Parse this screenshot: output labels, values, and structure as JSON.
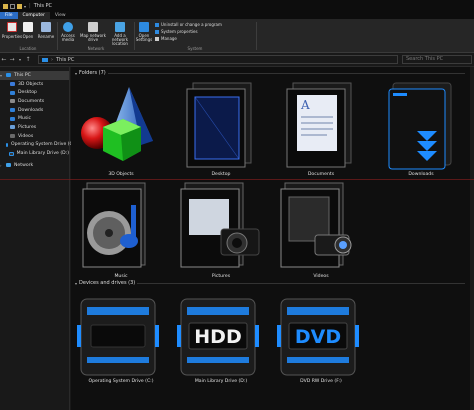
{
  "window": {
    "title": "This PC",
    "separator": "|"
  },
  "tabs": [
    "File",
    "Computer",
    "View"
  ],
  "ribbon": {
    "location_buttons": [
      "Properties",
      "Open",
      "Rename"
    ],
    "location_label": "Location",
    "network_buttons": [
      "Access media",
      "Map network drive",
      "Add a network location"
    ],
    "network_label": "Network",
    "system_buttons": [
      "Open Settings"
    ],
    "system_links": [
      "Uninstall or change a program",
      "System properties",
      "Manage"
    ],
    "system_label": "System"
  },
  "address": {
    "path": "This PC",
    "search_placeholder": "Search This PC"
  },
  "sidebar": {
    "items": [
      {
        "label": "This PC",
        "selected": true
      },
      {
        "label": "3D Objects"
      },
      {
        "label": "Desktop"
      },
      {
        "label": "Documents"
      },
      {
        "label": "Downloads"
      },
      {
        "label": "Music"
      },
      {
        "label": "Pictures"
      },
      {
        "label": "Videos"
      },
      {
        "label": "Operating System Drive (C:)"
      },
      {
        "label": "Main Library Drive (D:)"
      },
      {
        "label": "Network"
      }
    ]
  },
  "folders": {
    "header": "Folders (7)",
    "items": [
      {
        "label": "3D Objects",
        "icon": "3d-objects-icon"
      },
      {
        "label": "Desktop",
        "icon": "desktop-folder-icon"
      },
      {
        "label": "Documents",
        "icon": "documents-folder-icon"
      },
      {
        "label": "Downloads",
        "icon": "downloads-folder-icon"
      },
      {
        "label": "Music",
        "icon": "music-folder-icon"
      },
      {
        "label": "Pictures",
        "icon": "pictures-folder-icon"
      },
      {
        "label": "Videos",
        "icon": "videos-folder-icon"
      }
    ]
  },
  "drives": {
    "header": "Devices and drives (3)",
    "items": [
      {
        "label": "Operating System Drive (C:)",
        "badge": ""
      },
      {
        "label": "Main Library Drive (D:)",
        "badge": "HDD"
      },
      {
        "label": "DVD RW Drive (F:)",
        "badge": "DVD"
      }
    ]
  },
  "colors": {
    "accent": "#2b6cc4",
    "blue_glow": "#1e8cff",
    "bg": "#0f0f0f"
  }
}
